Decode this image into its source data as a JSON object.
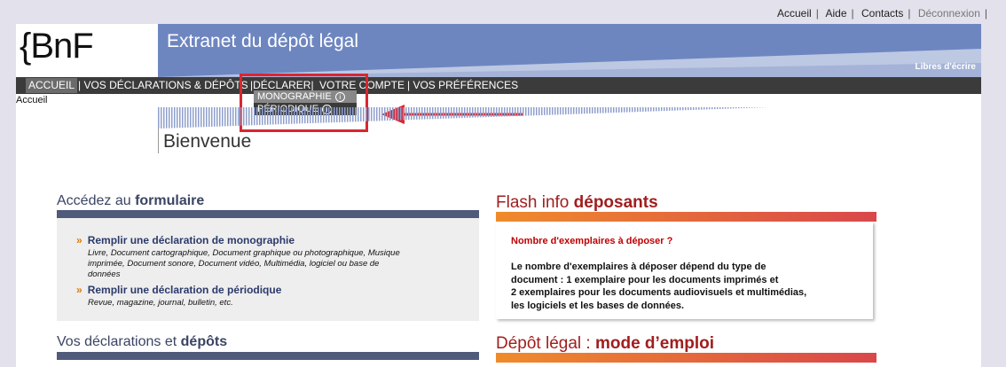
{
  "toplinks": [
    "Accueil",
    "Aide",
    "Contacts",
    "Déconnexion"
  ],
  "logo": "{BnF",
  "banner": {
    "title": "Extranet du dépôt légal",
    "right": "Libres d'écrire"
  },
  "nav": {
    "accueil": "ACCUEIL",
    "declarations": "| VOS DÉCLARATIONS & DÉPÔTS",
    "declarer": "|DÉCLARER|",
    "compte": "VOTRE COMPTE",
    "preferences": "| VOS PRÉFÉRENCES"
  },
  "submenu": {
    "monographie": "MONOGRAPHIE",
    "periodique": "PÉRIODIQUE",
    "info": "i"
  },
  "breadcrumb": "Accueil",
  "welcome": "Bienvenue",
  "formulaire": {
    "title_pre": "Accédez au",
    "title_b": "formulaire",
    "chev": "»",
    "link1": "Remplir une déclaration de monographie",
    "desc1a": "Livre, Document cartographique, Document graphique ou photographique, Musique",
    "desc1b": "imprimée, Document sonore, Document vidéo, Multimédia, logiciel ou base de",
    "desc1c": "données",
    "link2": "Remplir une déclaration de périodique",
    "desc2": "Revue, magazine, journal, bulletin, etc."
  },
  "declarations": {
    "title_pre": "Vos déclarations et",
    "title_b": "dépôts"
  },
  "flash": {
    "title_pre": "Flash info",
    "title_b": "déposants",
    "question": "Nombre d'exemplaires à déposer ?",
    "p1": "Le nombre d'exemplaires à déposer dépend du type de",
    "p2": "document : 1 exemplaire pour les documents imprimés et",
    "p3": "2 exemplaires pour les documents audiovisuels et multimédias,",
    "p4": "les logiciels et les bases de données."
  },
  "depot": {
    "title_pre": "Dépôt légal :",
    "title_b": "mode d’emploi"
  },
  "colors": {
    "banner": "#6e86c0",
    "nav": "#3b3b3b",
    "highlight": "#d9262f",
    "orange": "#ef8b2c"
  }
}
